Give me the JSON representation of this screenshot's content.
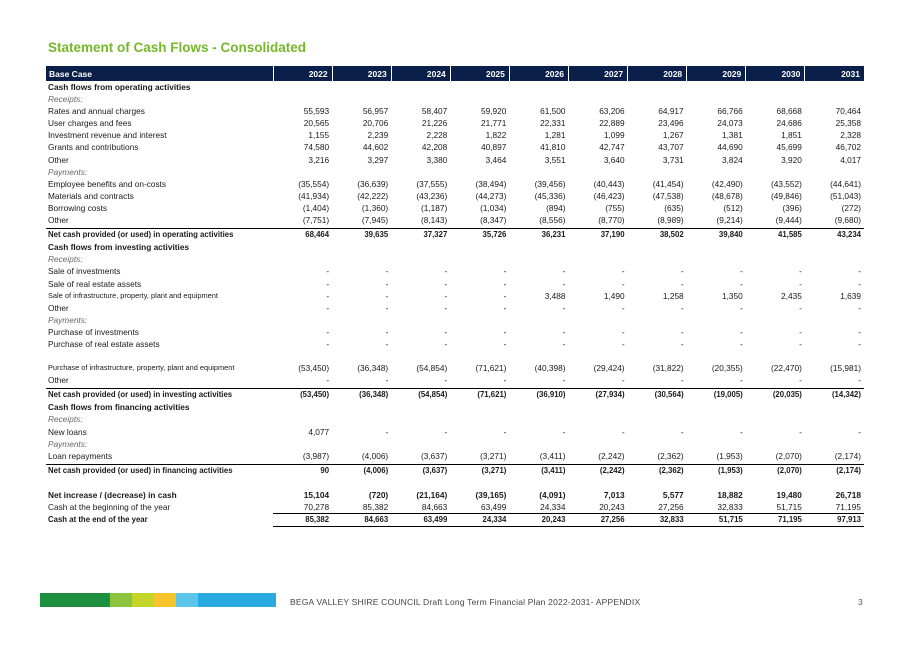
{
  "title": "Statement of Cash Flows - Consolidated",
  "header": {
    "label": "Base Case",
    "years": [
      "2022",
      "2023",
      "2024",
      "2025",
      "2026",
      "2027",
      "2028",
      "2029",
      "2030",
      "2031"
    ]
  },
  "rows": [
    {
      "type": "section",
      "label": "Cash flows from operating activities"
    },
    {
      "type": "italic",
      "label": "Receipts:"
    },
    {
      "type": "data",
      "label": "Rates and annual charges",
      "values": [
        "55,593",
        "56,957",
        "58,407",
        "59,920",
        "61,500",
        "63,206",
        "64,917",
        "66,766",
        "68,668",
        "70,464"
      ]
    },
    {
      "type": "data",
      "label": "User charges and fees",
      "values": [
        "20,565",
        "20,706",
        "21,226",
        "21,771",
        "22,331",
        "22,889",
        "23,496",
        "24,073",
        "24,686",
        "25,358"
      ]
    },
    {
      "type": "data",
      "label": "Investment revenue and interest",
      "values": [
        "1,155",
        "2,239",
        "2,228",
        "1,822",
        "1,281",
        "1,099",
        "1,267",
        "1,381",
        "1,851",
        "2,328"
      ]
    },
    {
      "type": "data",
      "label": "Grants and contributions",
      "values": [
        "74,580",
        "44,602",
        "42,208",
        "40,897",
        "41,810",
        "42,747",
        "43,707",
        "44,690",
        "45,699",
        "46,702"
      ]
    },
    {
      "type": "data",
      "label": "Other",
      "values": [
        "3,216",
        "3,297",
        "3,380",
        "3,464",
        "3,551",
        "3,640",
        "3,731",
        "3,824",
        "3,920",
        "4,017"
      ]
    },
    {
      "type": "italic",
      "label": "Payments:"
    },
    {
      "type": "data",
      "label": "Employee benefits and on-costs",
      "values": [
        "(35,554)",
        "(36,639)",
        "(37,555)",
        "(38,494)",
        "(39,456)",
        "(40,443)",
        "(41,454)",
        "(42,490)",
        "(43,552)",
        "(44,641)"
      ]
    },
    {
      "type": "data",
      "label": "Materials and contracts",
      "values": [
        "(41,934)",
        "(42,222)",
        "(43,236)",
        "(44,273)",
        "(45,336)",
        "(46,423)",
        "(47,538)",
        "(48,678)",
        "(49,846)",
        "(51,043)"
      ]
    },
    {
      "type": "data",
      "label": "Borrowing costs",
      "values": [
        "(1,404)",
        "(1,360)",
        "(1,187)",
        "(1,034)",
        "(894)",
        "(755)",
        "(635)",
        "(512)",
        "(396)",
        "(272)"
      ]
    },
    {
      "type": "data",
      "label": "Other",
      "values": [
        "(7,751)",
        "(7,945)",
        "(8,143)",
        "(8,347)",
        "(8,556)",
        "(8,770)",
        "(8,989)",
        "(9,214)",
        "(9,444)",
        "(9,680)"
      ]
    },
    {
      "type": "gap"
    },
    {
      "type": "total",
      "label": "Net cash provided (or used) in operating activities",
      "values": [
        "68,464",
        "39,635",
        "37,327",
        "35,726",
        "36,231",
        "37,190",
        "38,502",
        "39,840",
        "41,585",
        "43,234"
      ]
    },
    {
      "type": "section",
      "label": "Cash flows from investing activities"
    },
    {
      "type": "italic",
      "label": "Receipts:"
    },
    {
      "type": "data",
      "label": "Sale of investments",
      "values": [
        "-",
        "-",
        "-",
        "-",
        "-",
        "-",
        "-",
        "-",
        "-",
        "-"
      ]
    },
    {
      "type": "data",
      "label": "Sale of real estate assets",
      "values": [
        "-",
        "-",
        "-",
        "-",
        "-",
        "-",
        "-",
        "-",
        "-",
        "-"
      ]
    },
    {
      "type": "small",
      "label": "Sale of infrastructure, property, plant and equipment",
      "values": [
        "-",
        "-",
        "-",
        "-",
        "3,488",
        "1,490",
        "1,258",
        "1,350",
        "2,435",
        "1,639"
      ]
    },
    {
      "type": "data",
      "label": "Other",
      "values": [
        "-",
        "-",
        "-",
        "-",
        "-",
        "-",
        "-",
        "-",
        "-",
        "-"
      ]
    },
    {
      "type": "italic",
      "label": "Payments:"
    },
    {
      "type": "data",
      "label": "Purchase of investments",
      "values": [
        "-",
        "-",
        "-",
        "-",
        "-",
        "-",
        "-",
        "-",
        "-",
        "-"
      ]
    },
    {
      "type": "data",
      "label": "Purchase of real estate assets",
      "values": [
        "-",
        "-",
        "-",
        "-",
        "-",
        "-",
        "-",
        "-",
        "-",
        "-"
      ]
    },
    {
      "type": "gap-lg"
    },
    {
      "type": "small",
      "label": "Purchase of infrastructure, property, plant and equipment",
      "values": [
        "(53,450)",
        "(36,348)",
        "(54,854)",
        "(71,621)",
        "(40,398)",
        "(29,424)",
        "(31,822)",
        "(20,355)",
        "(22,470)",
        "(15,981)"
      ]
    },
    {
      "type": "data",
      "label": "Other",
      "values": [
        "-",
        "-",
        "-",
        "-",
        "-",
        "-",
        "-",
        "-",
        "-",
        "-"
      ]
    },
    {
      "type": "gap"
    },
    {
      "type": "total",
      "label": "Net cash provided (or used) in investing activities",
      "values": [
        "(53,450)",
        "(36,348)",
        "(54,854)",
        "(71,621)",
        "(36,910)",
        "(27,934)",
        "(30,564)",
        "(19,005)",
        "(20,035)",
        "(14,342)"
      ]
    },
    {
      "type": "section",
      "label": "Cash flows from financing activities"
    },
    {
      "type": "italic",
      "label": "Receipts:"
    },
    {
      "type": "data",
      "label": "New loans",
      "values": [
        "4,077",
        "-",
        "-",
        "-",
        "-",
        "-",
        "-",
        "-",
        "-",
        "-"
      ]
    },
    {
      "type": "italic",
      "label": "Payments:"
    },
    {
      "type": "data",
      "label": "Loan repayments",
      "values": [
        "(3,987)",
        "(4,006)",
        "(3,637)",
        "(3,271)",
        "(3,411)",
        "(2,242)",
        "(2,362)",
        "(1,953)",
        "(2,070)",
        "(2,174)"
      ]
    },
    {
      "type": "gap"
    },
    {
      "type": "total",
      "label": "Net cash provided (or used) in financing activities",
      "values": [
        "90",
        "(4,006)",
        "(3,637)",
        "(3,271)",
        "(3,411)",
        "(2,242)",
        "(2,362)",
        "(1,953)",
        "(2,070)",
        "(2,174)"
      ]
    },
    {
      "type": "gap-lg"
    },
    {
      "type": "bold-data",
      "label": "Net increase / (decrease) in cash",
      "values": [
        "15,104",
        "(720)",
        "(21,164)",
        "(39,165)",
        "(4,091)",
        "7,013",
        "5,577",
        "18,882",
        "19,480",
        "26,718"
      ]
    },
    {
      "type": "under",
      "label": "Cash at the beginning of the year",
      "values": [
        "70,278",
        "85,382",
        "84,663",
        "63,499",
        "24,334",
        "20,243",
        "27,256",
        "32,833",
        "51,715",
        "71,195"
      ]
    },
    {
      "type": "final",
      "label": "Cash at the end of the year",
      "values": [
        "85,382",
        "84,663",
        "63,499",
        "24,334",
        "20,243",
        "27,256",
        "32,833",
        "51,715",
        "71,195",
        "97,913"
      ]
    }
  ],
  "footer": {
    "text": "BEGA VALLEY SHIRE COUNCIL  Draft Long Term Financial Plan 2022-2031- APPENDIX",
    "page": "3",
    "bar_colors": [
      "#1e8f3e",
      "#1e8f3e",
      "#8cc43f",
      "#c6d52a",
      "#f5c52a",
      "#5bc4e8",
      "#2aa8e0"
    ]
  }
}
